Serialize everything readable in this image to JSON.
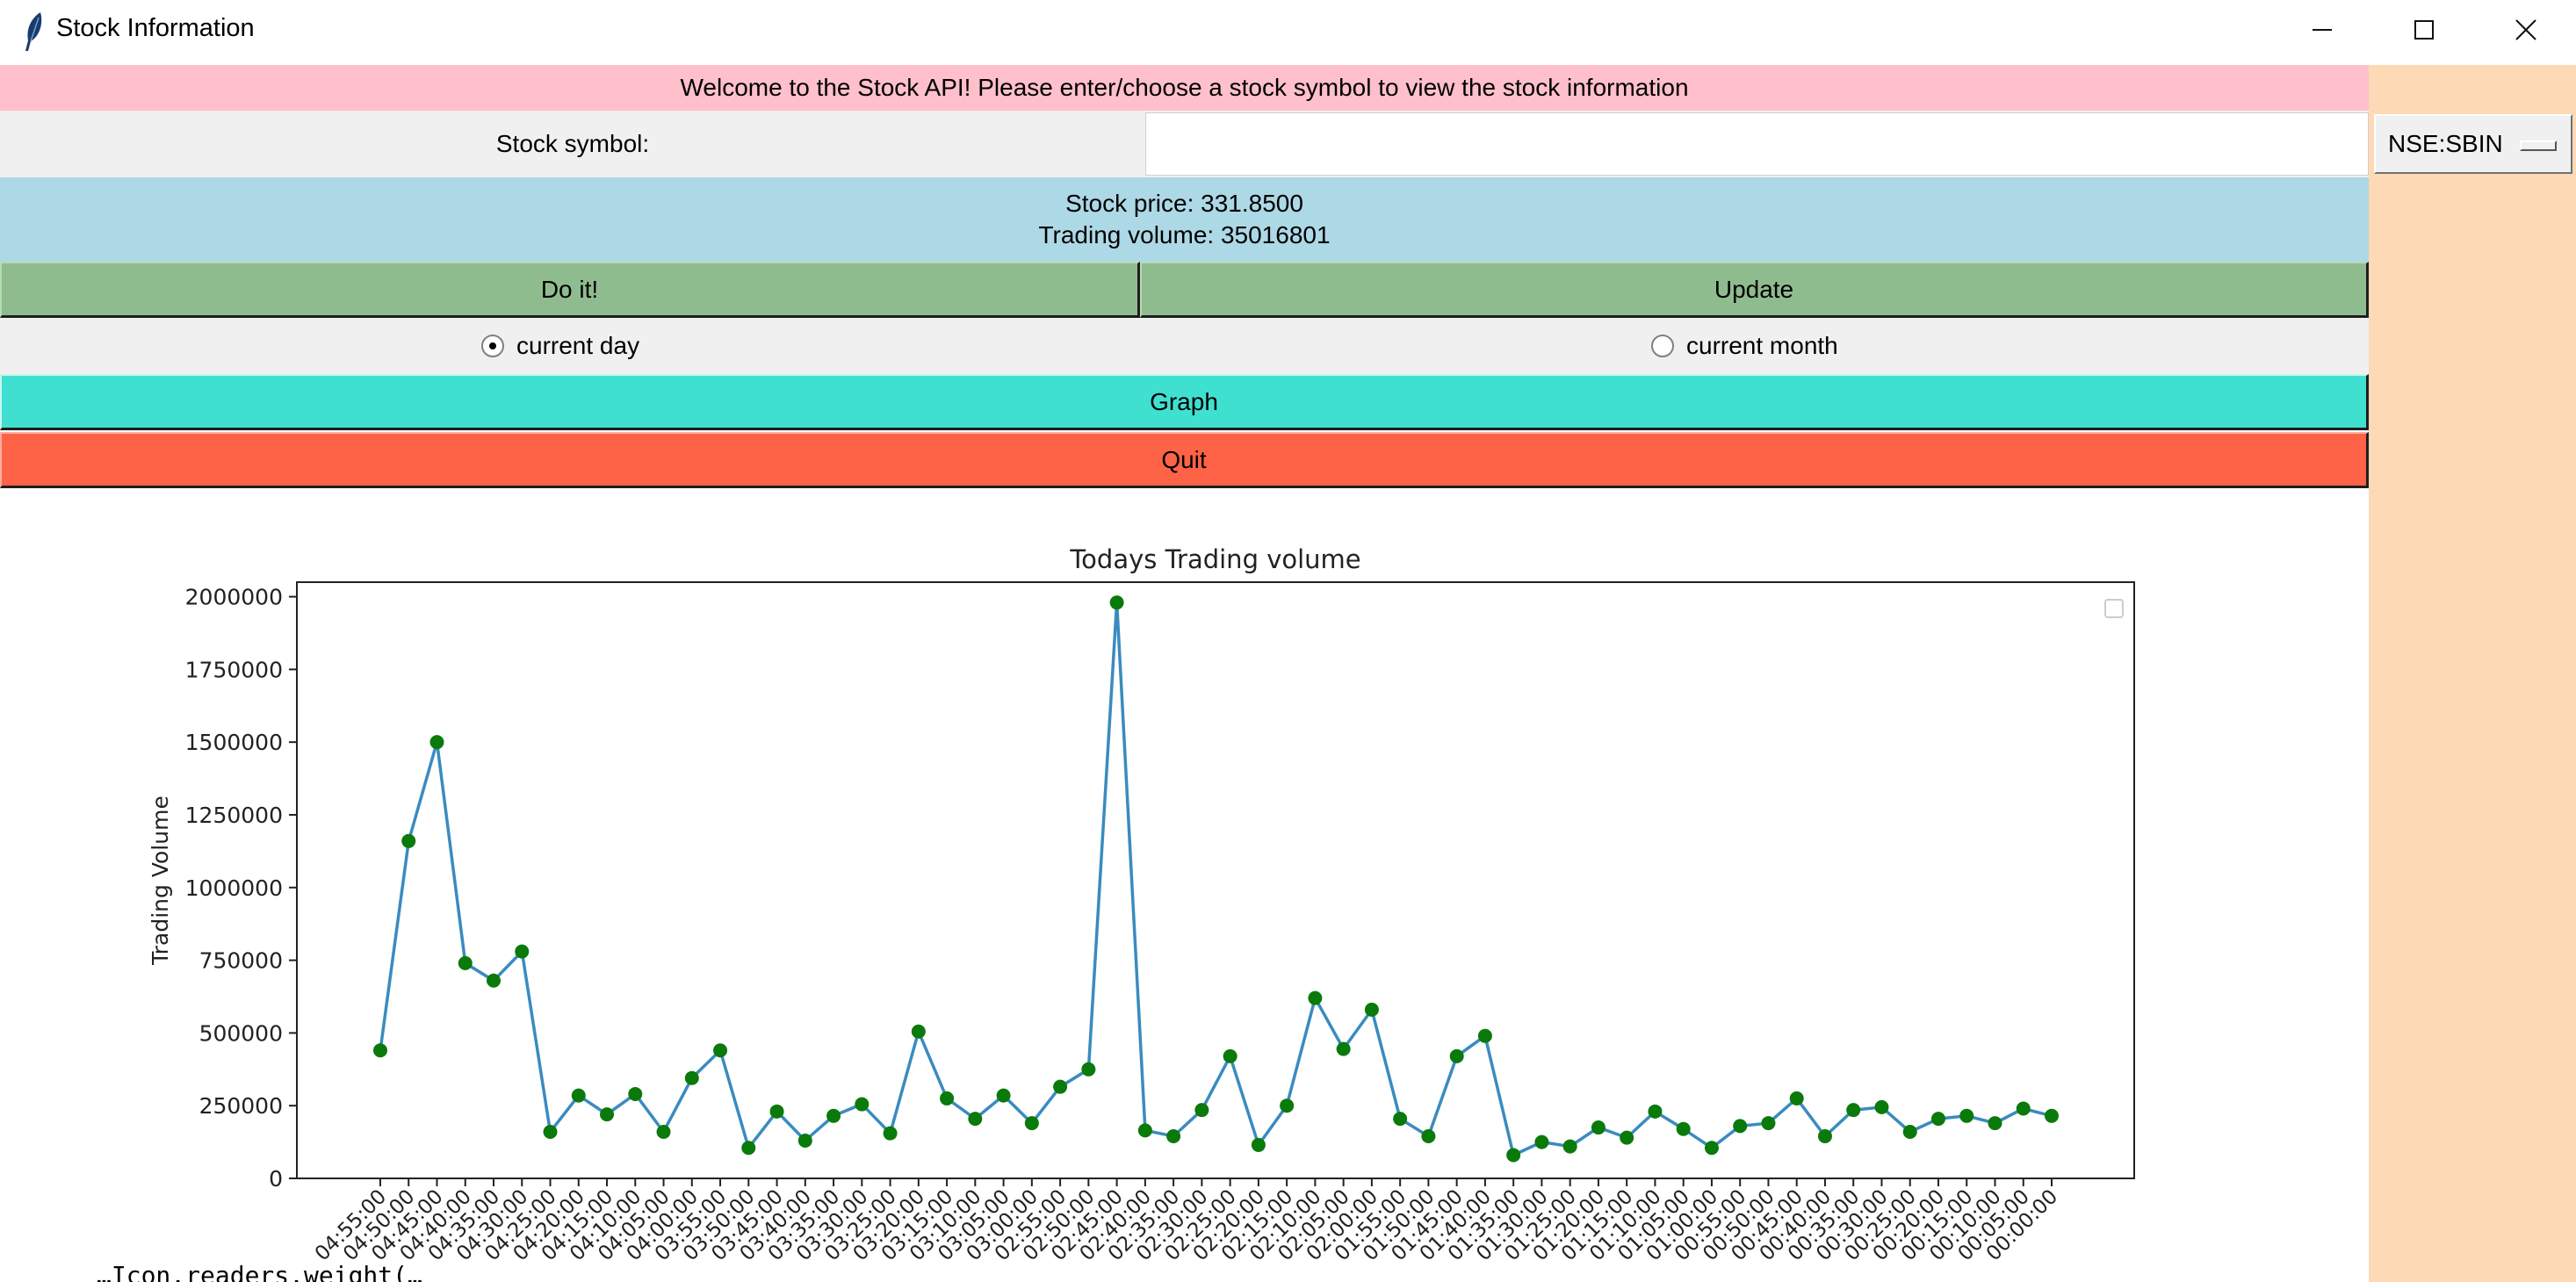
{
  "window": {
    "title": "Stock Information"
  },
  "welcome": {
    "text": "Welcome to the Stock API! Please enter/choose a stock symbol to view the stock information"
  },
  "symbol": {
    "label": "Stock symbol:",
    "input_value": "",
    "selected_option": "NSE:SBIN"
  },
  "info": {
    "price_line": "Stock price: 331.8500",
    "volume_line": "Trading volume: 35016801"
  },
  "buttons": {
    "do_it": "Do it!",
    "update": "Update",
    "graph": "Graph",
    "quit": "Quit"
  },
  "radios": {
    "day_label": "current day",
    "month_label": "current month",
    "selected": "current day"
  },
  "colors": {
    "welcome_bg": "#ffc0cb",
    "info_bg": "#add8e6",
    "button_green": "#8fbc8f",
    "graph_turquoise": "#40e0d0",
    "quit_tomato": "#ff6347",
    "side_panel": "#fdd9b5",
    "line": "#3a8bc0",
    "markers": "#0a7a0a"
  },
  "chart_data": {
    "type": "line",
    "title": "Todays Trading volume",
    "xlabel": "",
    "ylabel": "Trading Volume",
    "ylim": [
      0,
      2050000
    ],
    "yticks": [
      0,
      250000,
      500000,
      750000,
      1000000,
      1250000,
      1500000,
      1750000,
      2000000
    ],
    "yticklabels": [
      "0",
      "250000",
      "500000",
      "750000",
      "1000000",
      "1250000",
      "1500000",
      "1750000",
      "2000000"
    ],
    "legend": "top-right (empty)",
    "grid": false,
    "categories": [
      "04:55:00",
      "04:50:00",
      "04:45:00",
      "04:40:00",
      "04:35:00",
      "04:30:00",
      "04:25:00",
      "04:20:00",
      "04:15:00",
      "04:10:00",
      "04:05:00",
      "04:00:00",
      "03:55:00",
      "03:50:00",
      "03:45:00",
      "03:40:00",
      "03:35:00",
      "03:30:00",
      "03:25:00",
      "03:20:00",
      "03:15:00",
      "03:10:00",
      "03:05:00",
      "03:00:00",
      "02:55:00",
      "02:50:00",
      "02:45:00",
      "02:40:00",
      "02:35:00",
      "02:30:00",
      "02:25:00",
      "02:20:00",
      "02:15:00",
      "02:10:00",
      "02:05:00",
      "02:00:00",
      "01:55:00",
      "01:50:00",
      "01:45:00",
      "01:40:00",
      "01:35:00",
      "01:30:00",
      "01:25:00",
      "01:20:00",
      "01:15:00",
      "01:10:00",
      "01:05:00",
      "01:00:00",
      "00:55:00",
      "00:50:00",
      "00:45:00",
      "00:40:00",
      "00:35:00",
      "00:30:00",
      "00:25:00",
      "00:20:00",
      "00:15:00",
      "00:10:00",
      "00:05:00",
      "00:00:00"
    ],
    "values": [
      440000,
      1160000,
      1500000,
      740000,
      680000,
      780000,
      160000,
      285000,
      220000,
      290000,
      160000,
      345000,
      440000,
      105000,
      230000,
      130000,
      215000,
      255000,
      155000,
      505000,
      275000,
      205000,
      285000,
      190000,
      315000,
      375000,
      1980000,
      165000,
      145000,
      235000,
      420000,
      115000,
      250000,
      620000,
      445000,
      580000,
      205000,
      145000,
      420000,
      490000,
      80000,
      125000,
      110000,
      175000,
      140000,
      230000,
      170000,
      105000,
      180000,
      190000,
      275000,
      145000,
      235000,
      245000,
      160000,
      205000,
      215000,
      190000,
      240000,
      215000
    ]
  },
  "bottom_text": "…Icon.readers.weight(…"
}
